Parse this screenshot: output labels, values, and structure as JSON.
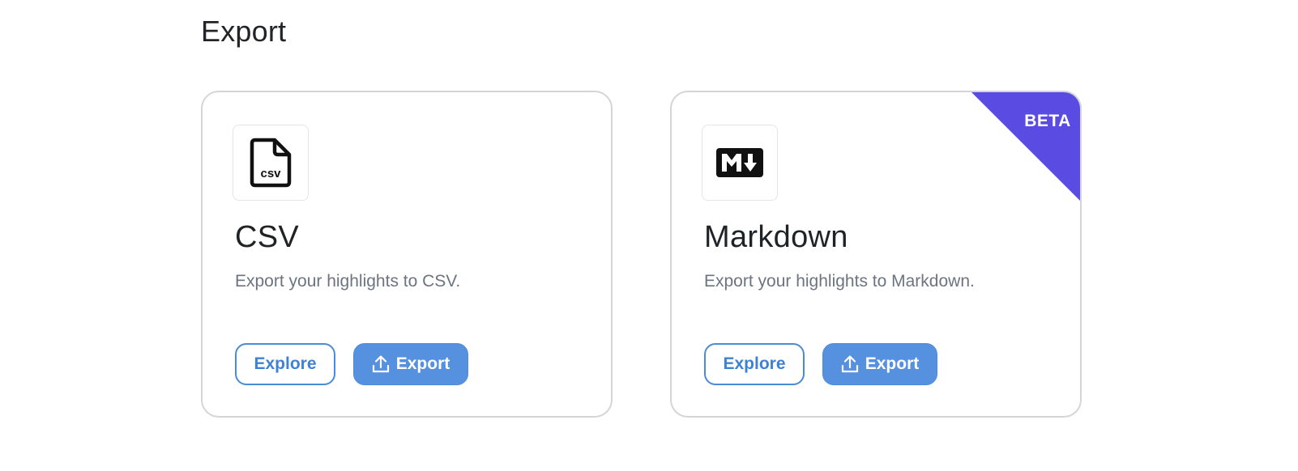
{
  "page": {
    "title": "Export"
  },
  "cards": [
    {
      "icon": "csv-file-icon",
      "title": "CSV",
      "description": "Export your highlights to CSV.",
      "explore_label": "Explore",
      "export_label": "Export",
      "icon_text": "csv"
    },
    {
      "icon": "markdown-icon",
      "title": "Markdown",
      "description": "Export your highlights to Markdown.",
      "explore_label": "Explore",
      "export_label": "Export",
      "badge": "BETA"
    }
  ],
  "colors": {
    "accent": "#5691e0",
    "outline": "#4a8bd8",
    "beta": "#5a4be3",
    "muted_text": "#6b7480"
  }
}
